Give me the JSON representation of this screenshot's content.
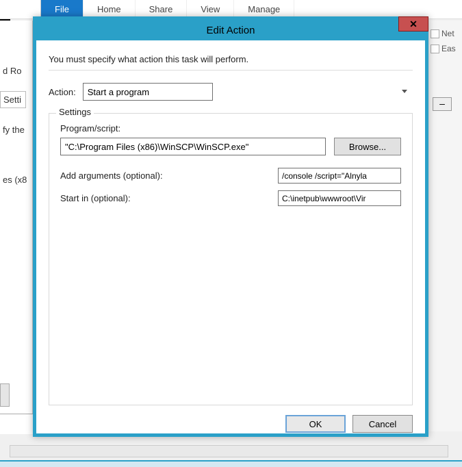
{
  "ribbon": {
    "tabs": [
      "File",
      "Home",
      "Share",
      "View",
      "Manage"
    ],
    "active_index": 0
  },
  "background": {
    "left_fragments": {
      "roles": "d Ro",
      "settings": "Setti",
      "fy_the": "fy the",
      "es_x8": "es (x8"
    },
    "right_items": {
      "net": "Net",
      "eas": "Eas"
    },
    "minus": "–"
  },
  "dialog": {
    "title": "Edit Action",
    "close_symbol": "✕",
    "intro": "You must specify what action this task will perform.",
    "action_label": "Action:",
    "action_value": "Start a program",
    "settings_legend": "Settings",
    "program_label": "Program/script:",
    "program_value": "\"C:\\Program Files (x86)\\WinSCP\\WinSCP.exe\"",
    "browse_label": "Browse...",
    "args_label": "Add arguments (optional):",
    "args_value": "/console /script=\"Alnyla",
    "startin_label": "Start in (optional):",
    "startin_value": "C:\\inetpub\\wwwroot\\Vir",
    "ok_label": "OK",
    "cancel_label": "Cancel"
  }
}
